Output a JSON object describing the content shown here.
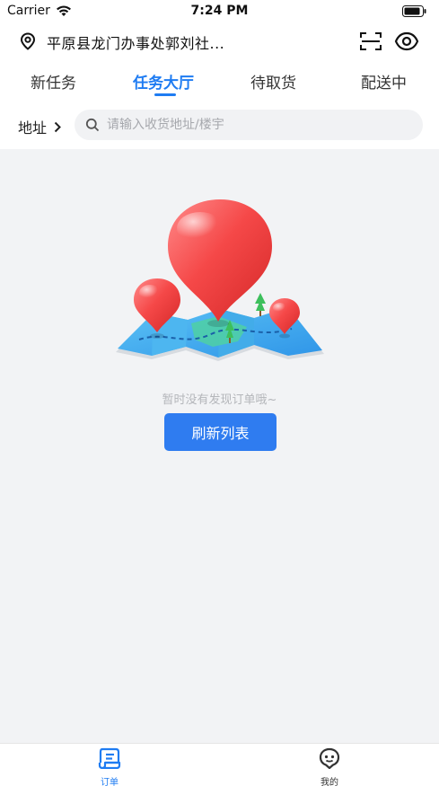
{
  "status_bar": {
    "carrier": "Carrier",
    "time": "7:24 PM"
  },
  "location": {
    "address": "平原县龙门办事处郭刘社..."
  },
  "tabs": [
    {
      "label": "新任务",
      "active": false
    },
    {
      "label": "任务大厅",
      "active": true
    },
    {
      "label": "待取货",
      "active": false
    },
    {
      "label": "配送中",
      "active": false
    }
  ],
  "search": {
    "filter_label": "地址",
    "placeholder": "请输入收货地址/楼宇"
  },
  "empty_state": {
    "message": "暂时没有发现订单哦~",
    "button_label": "刷新列表"
  },
  "tab_bar": {
    "items": [
      {
        "label": "订单",
        "active": true,
        "icon": "orders-icon"
      },
      {
        "label": "我的",
        "active": false,
        "icon": "profile-icon"
      }
    ]
  },
  "colors": {
    "accent": "#1f7cf2",
    "button": "#2f7cf0",
    "background": "#f2f3f5"
  }
}
